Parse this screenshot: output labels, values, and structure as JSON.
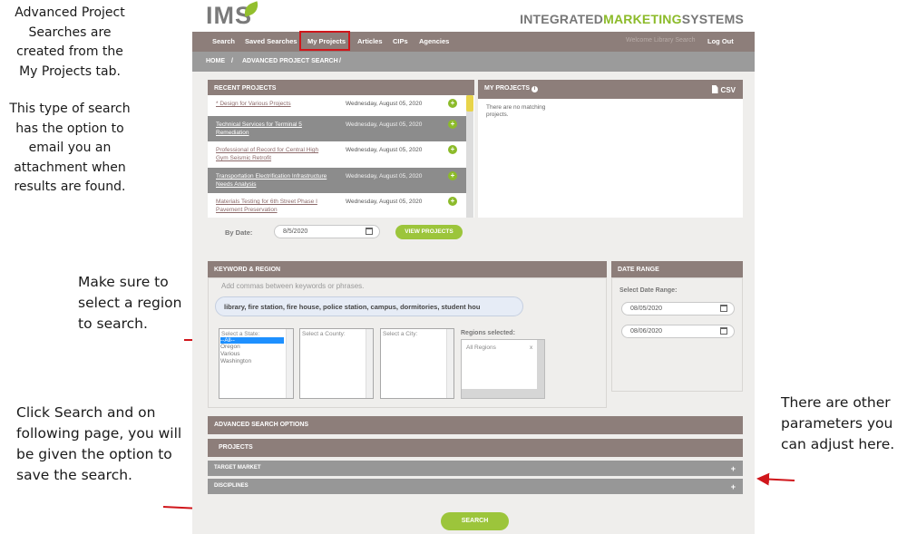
{
  "annotations": {
    "left1": [
      "Advanced Project",
      "Searches are",
      "created from the",
      "My Projects tab."
    ],
    "left2": [
      "This type of search",
      "has the option to",
      "email you an",
      "attachment when",
      "results are found."
    ],
    "region": [
      "Make sure to",
      "select a region",
      "to search."
    ],
    "search": [
      "Click Search and on",
      "following page, you will",
      "be given the option to",
      "save the search."
    ],
    "params": [
      "There are other",
      "parameters you",
      "can adjust here."
    ]
  },
  "header": {
    "logo": "IMS",
    "brand_a": "INTEGRATED",
    "brand_b": "MARKETING",
    "brand_c": "SYSTEMS"
  },
  "nav": {
    "items": [
      "Search",
      "Saved Searches",
      "My Projects",
      "Articles",
      "CIPs",
      "Agencies"
    ],
    "welcome": "Welcome Library Search",
    "logout": "Log Out"
  },
  "breadcrumb": {
    "home": "HOME",
    "sep1": "/",
    "current": "ADVANCED PROJECT SEARCH",
    "sep2": "/"
  },
  "recent": {
    "title": "RECENT PROJECTS",
    "rows": [
      {
        "name": "* Design for Various Projects",
        "date": "Wednesday, August 05, 2020"
      },
      {
        "name": "Technical Services for Terminal 5 Remediation",
        "date": "Wednesday, August 05, 2020"
      },
      {
        "name": "Professional of Record for Central High Gym Seismic Retrofit",
        "date": "Wednesday, August 05, 2020"
      },
      {
        "name": "Transportation Electrification Infrastructure Needs Analysis",
        "date": "Wednesday, August 05, 2020"
      },
      {
        "name": "Materials Testing for 6th Street Phase I Pavement Preservation",
        "date": "Wednesday, August 05, 2020"
      }
    ]
  },
  "my_projects": {
    "title": "MY PROJECTS",
    "csv": "CSV",
    "empty": "There are no matching projects."
  },
  "by_date": {
    "label": "By Date:",
    "value": "8/5/2020",
    "button": "VIEW PROJECTS"
  },
  "keyword_region": {
    "title": "KEYWORD & REGION",
    "hint": "Add commas between keywords or phrases.",
    "keywords": "library, fire station, fire house, police station, campus, dormitories, student hou",
    "state_placeholder": "Select a State:",
    "states": [
      "--All--",
      "Oregon",
      "Various",
      "Washington"
    ],
    "county_placeholder": "Select a County:",
    "city_placeholder": "Select a City:",
    "regions_label": "Regions selected:",
    "regions_value": "All Regions",
    "regions_remove": "x"
  },
  "date_range": {
    "title": "DATE RANGE",
    "label": "Select Date Range:",
    "start": "08/05/2020",
    "end": "08/06/2020"
  },
  "advanced": {
    "title": "ADVANCED SEARCH OPTIONS",
    "projects": "PROJECTS",
    "target_market": "TARGET MARKET",
    "disciplines": "DISCIPLINES",
    "expand": "+"
  },
  "search_button": "SEARCH",
  "colors": {
    "header_bar": "#8d7e7a",
    "accent_green": "#9cc53b",
    "highlight_red": "#d0161b"
  }
}
